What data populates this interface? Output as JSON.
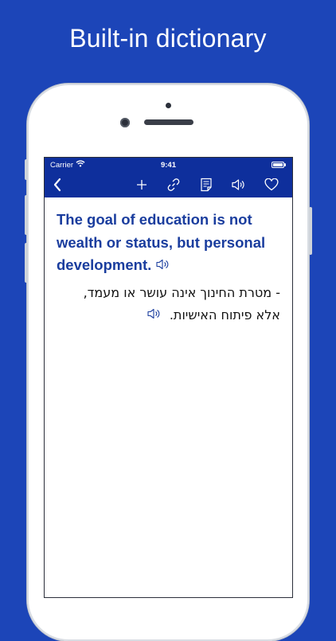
{
  "headline": "Built-in dictionary",
  "status_bar": {
    "carrier": "Carrier",
    "time": "9:41"
  },
  "toolbar": {
    "icons": [
      "back-chevron-icon",
      "add-icon",
      "link-icon",
      "notes-icon",
      "speaker-icon",
      "heart-icon"
    ]
  },
  "entry": {
    "english": "The goal of education is not wealth or status, but personal development.",
    "hebrew_line1": "- מטרת החינוך אינה עושר או מעמד,",
    "hebrew_line2": "אלא פיתוח האישיות."
  },
  "colors": {
    "background": "#1c45b8",
    "bar": "#0e2f9c",
    "english_text": "#1a3d9e"
  }
}
